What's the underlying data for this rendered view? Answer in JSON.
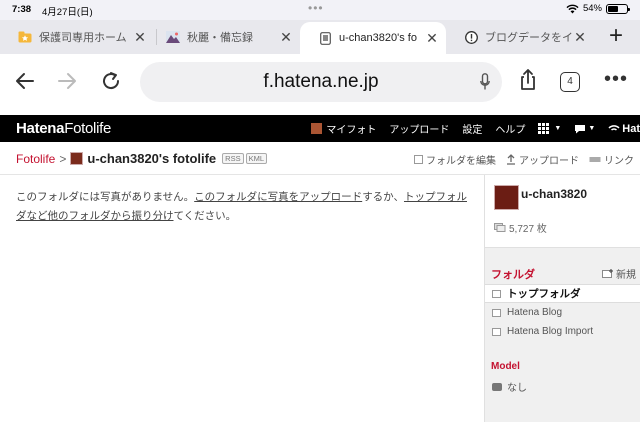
{
  "status": {
    "time": "7:38",
    "date": "4月27日(日)",
    "battery": "54%",
    "battery_level": 0.54
  },
  "tabs": [
    {
      "title": "保護司専用ホーム",
      "favicon": "star-folder-icon",
      "active": false
    },
    {
      "title": "秋麗・備忘録",
      "favicon": "mountain-icon",
      "active": false
    },
    {
      "title": "u-chan3820's fo",
      "favicon": "page-icon",
      "active": true
    },
    {
      "title": "ブログデータをイ",
      "favicon": "exclamation-icon",
      "active": false
    }
  ],
  "toolbar": {
    "url": "f.hatena.ne.jp",
    "tab_count": "4"
  },
  "hatena": {
    "logo_bold": "Hatena",
    "logo_light": "Fotolife",
    "nav": {
      "my_photo": "マイフォト",
      "upload": "アップロード",
      "settings": "設定",
      "help": "ヘルプ",
      "brand": "Hat"
    }
  },
  "breadcrumb": {
    "root": "Fotolife",
    "separator": ">",
    "title": "u-chan3820's fotolife",
    "badge_rss": "RSS",
    "badge_kml": "KML",
    "actions": {
      "edit_folders": "フォルダを編集",
      "upload": "アップロード",
      "links": "リンク"
    }
  },
  "main": {
    "msg_prefix": "このフォルダには写真がありません。",
    "link_upload": "このフォルダに写真をアップロード",
    "msg_mid": "するか、",
    "link_sort": "トップフォルダなど他のフォルダから振り分け",
    "msg_suffix": "てください。"
  },
  "sidebar": {
    "username": "u-chan3820",
    "photo_count": "5,727 枚",
    "folder_heading": "フォルダ",
    "new_label": "新規",
    "folders": [
      "トップフォルダ",
      "Hatena Blog",
      "Hatena Blog Import"
    ],
    "model_heading": "Model",
    "model_value": "なし"
  }
}
